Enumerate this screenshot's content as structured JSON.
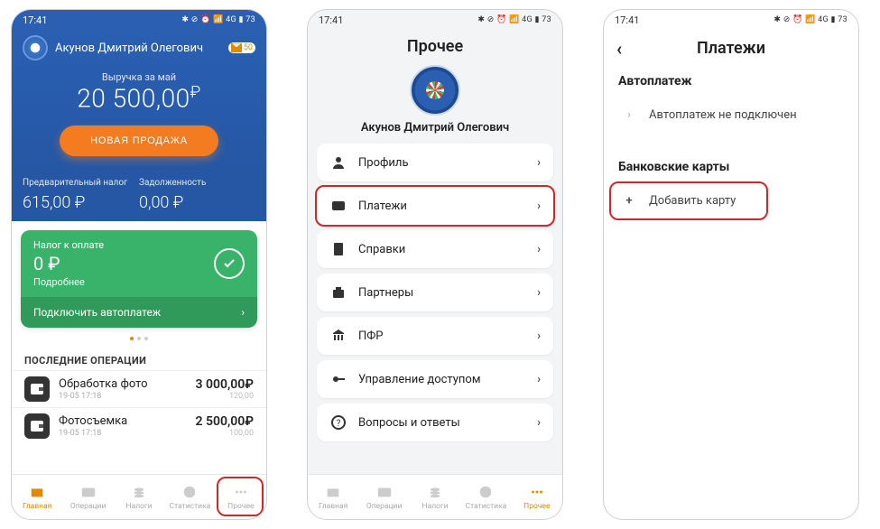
{
  "status": {
    "time": "17:41",
    "right": "✱ ⊘ ⏰ 📶 4G ▮ 73"
  },
  "s1": {
    "user": "Акунов Дмитрий Олегович",
    "mail_count": "50",
    "rev_label": "Выручка за май",
    "rev_value": "20 500,00",
    "rev_cur": "₽",
    "btn_sale": "НОВАЯ ПРОДАЖА",
    "pretax_label": "Предварительный налог",
    "pretax_value": "615,00 ₽",
    "debt_label": "Задолженность",
    "debt_value": "0,00 ₽",
    "tax_card": {
      "title": "Налог к оплате",
      "amount": "0 ₽",
      "more": "Подробнее",
      "autopay": "Подключить автоплатеж"
    },
    "ops_header": "ПОСЛЕДНИЕ ОПЕРАЦИИ",
    "ops": [
      {
        "name": "Обработка фото",
        "ts": "19-05 17:18",
        "sum": "3 000,00₽",
        "sub": "120,00"
      },
      {
        "name": "Фотосъемка",
        "ts": "19-05 17:18",
        "sum": "2 500,00₽",
        "sub": "100,00"
      }
    ],
    "nav": [
      "Главная",
      "Операции",
      "Налоги",
      "Статистика",
      "Прочее"
    ]
  },
  "s2": {
    "title": "Прочее",
    "user": "Акунов Дмитрий Олегович",
    "items": [
      "Профиль",
      "Платежи",
      "Справки",
      "Партнеры",
      "ПФР",
      "Управление доступом",
      "Вопросы и ответы"
    ],
    "nav": [
      "Главная",
      "Операции",
      "Налоги",
      "Статистика",
      "Прочее"
    ]
  },
  "s3": {
    "title": "Платежи",
    "sec1": "Автоплатеж",
    "autopay_row": "Автоплатеж не подключен",
    "sec2": "Банковские карты",
    "add_card": "Добавить карту"
  }
}
